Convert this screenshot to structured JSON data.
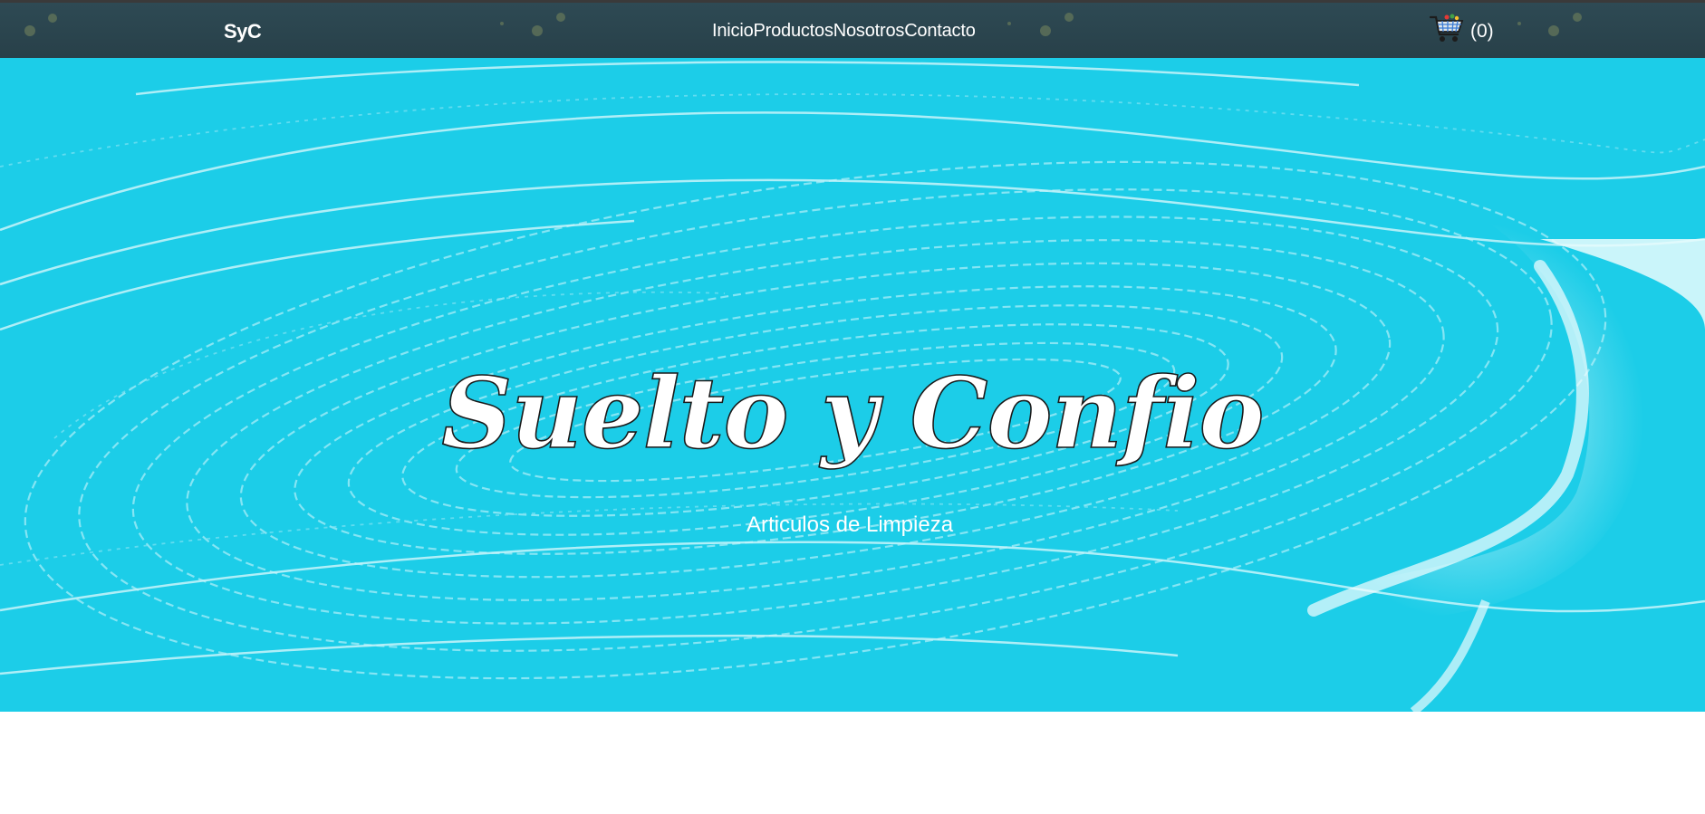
{
  "navbar": {
    "brand": "SyC",
    "links": [
      {
        "label": "Inicio"
      },
      {
        "label": "Productos"
      },
      {
        "label": "Nosotros"
      },
      {
        "label": "Contacto"
      }
    ],
    "cart": {
      "icon": "shopping-cart-icon",
      "count_label": "(0)"
    }
  },
  "hero": {
    "title": "Suelto y Confio",
    "subtitle": "Articulos de Limpieza"
  },
  "colors": {
    "navbar_bg": "#2b454e",
    "hero_bg": "#1ccde8",
    "foam": "#e6f8fb",
    "text": "#ffffff"
  }
}
